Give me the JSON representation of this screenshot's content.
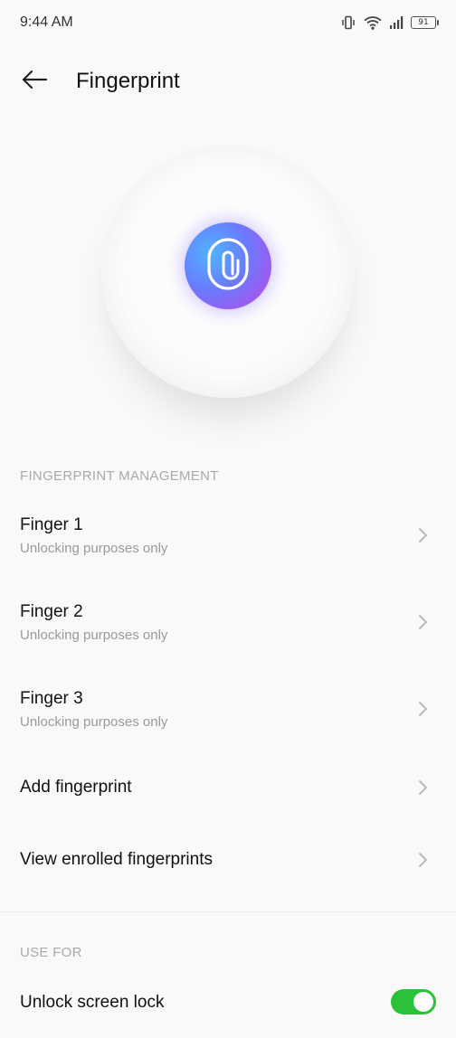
{
  "status_bar": {
    "time": "9:44 AM",
    "battery_level": "91",
    "icons": [
      "vibrate-icon",
      "wifi-icon",
      "signal-icon",
      "battery-icon"
    ]
  },
  "header": {
    "title": "Fingerprint",
    "back_icon": "arrow-left-icon"
  },
  "hero": {
    "icon": "fingerprint-icon"
  },
  "management": {
    "section_label": "FINGERPRINT MANAGEMENT",
    "fingers": [
      {
        "title": "Finger 1",
        "subtitle": "Unlocking purposes only"
      },
      {
        "title": "Finger 2",
        "subtitle": "Unlocking purposes only"
      },
      {
        "title": "Finger 3",
        "subtitle": "Unlocking purposes only"
      }
    ],
    "add_label": "Add fingerprint",
    "view_label": "View enrolled fingerprints"
  },
  "use_for": {
    "section_label": "USE FOR",
    "unlock_label": "Unlock screen lock",
    "unlock_enabled": true
  },
  "colors": {
    "toggle_on": "#2bc23a",
    "section_label": "#aaaaaa",
    "badge_gradient": [
      "#4fb3ff",
      "#6a7bff",
      "#9b5cf0"
    ]
  }
}
